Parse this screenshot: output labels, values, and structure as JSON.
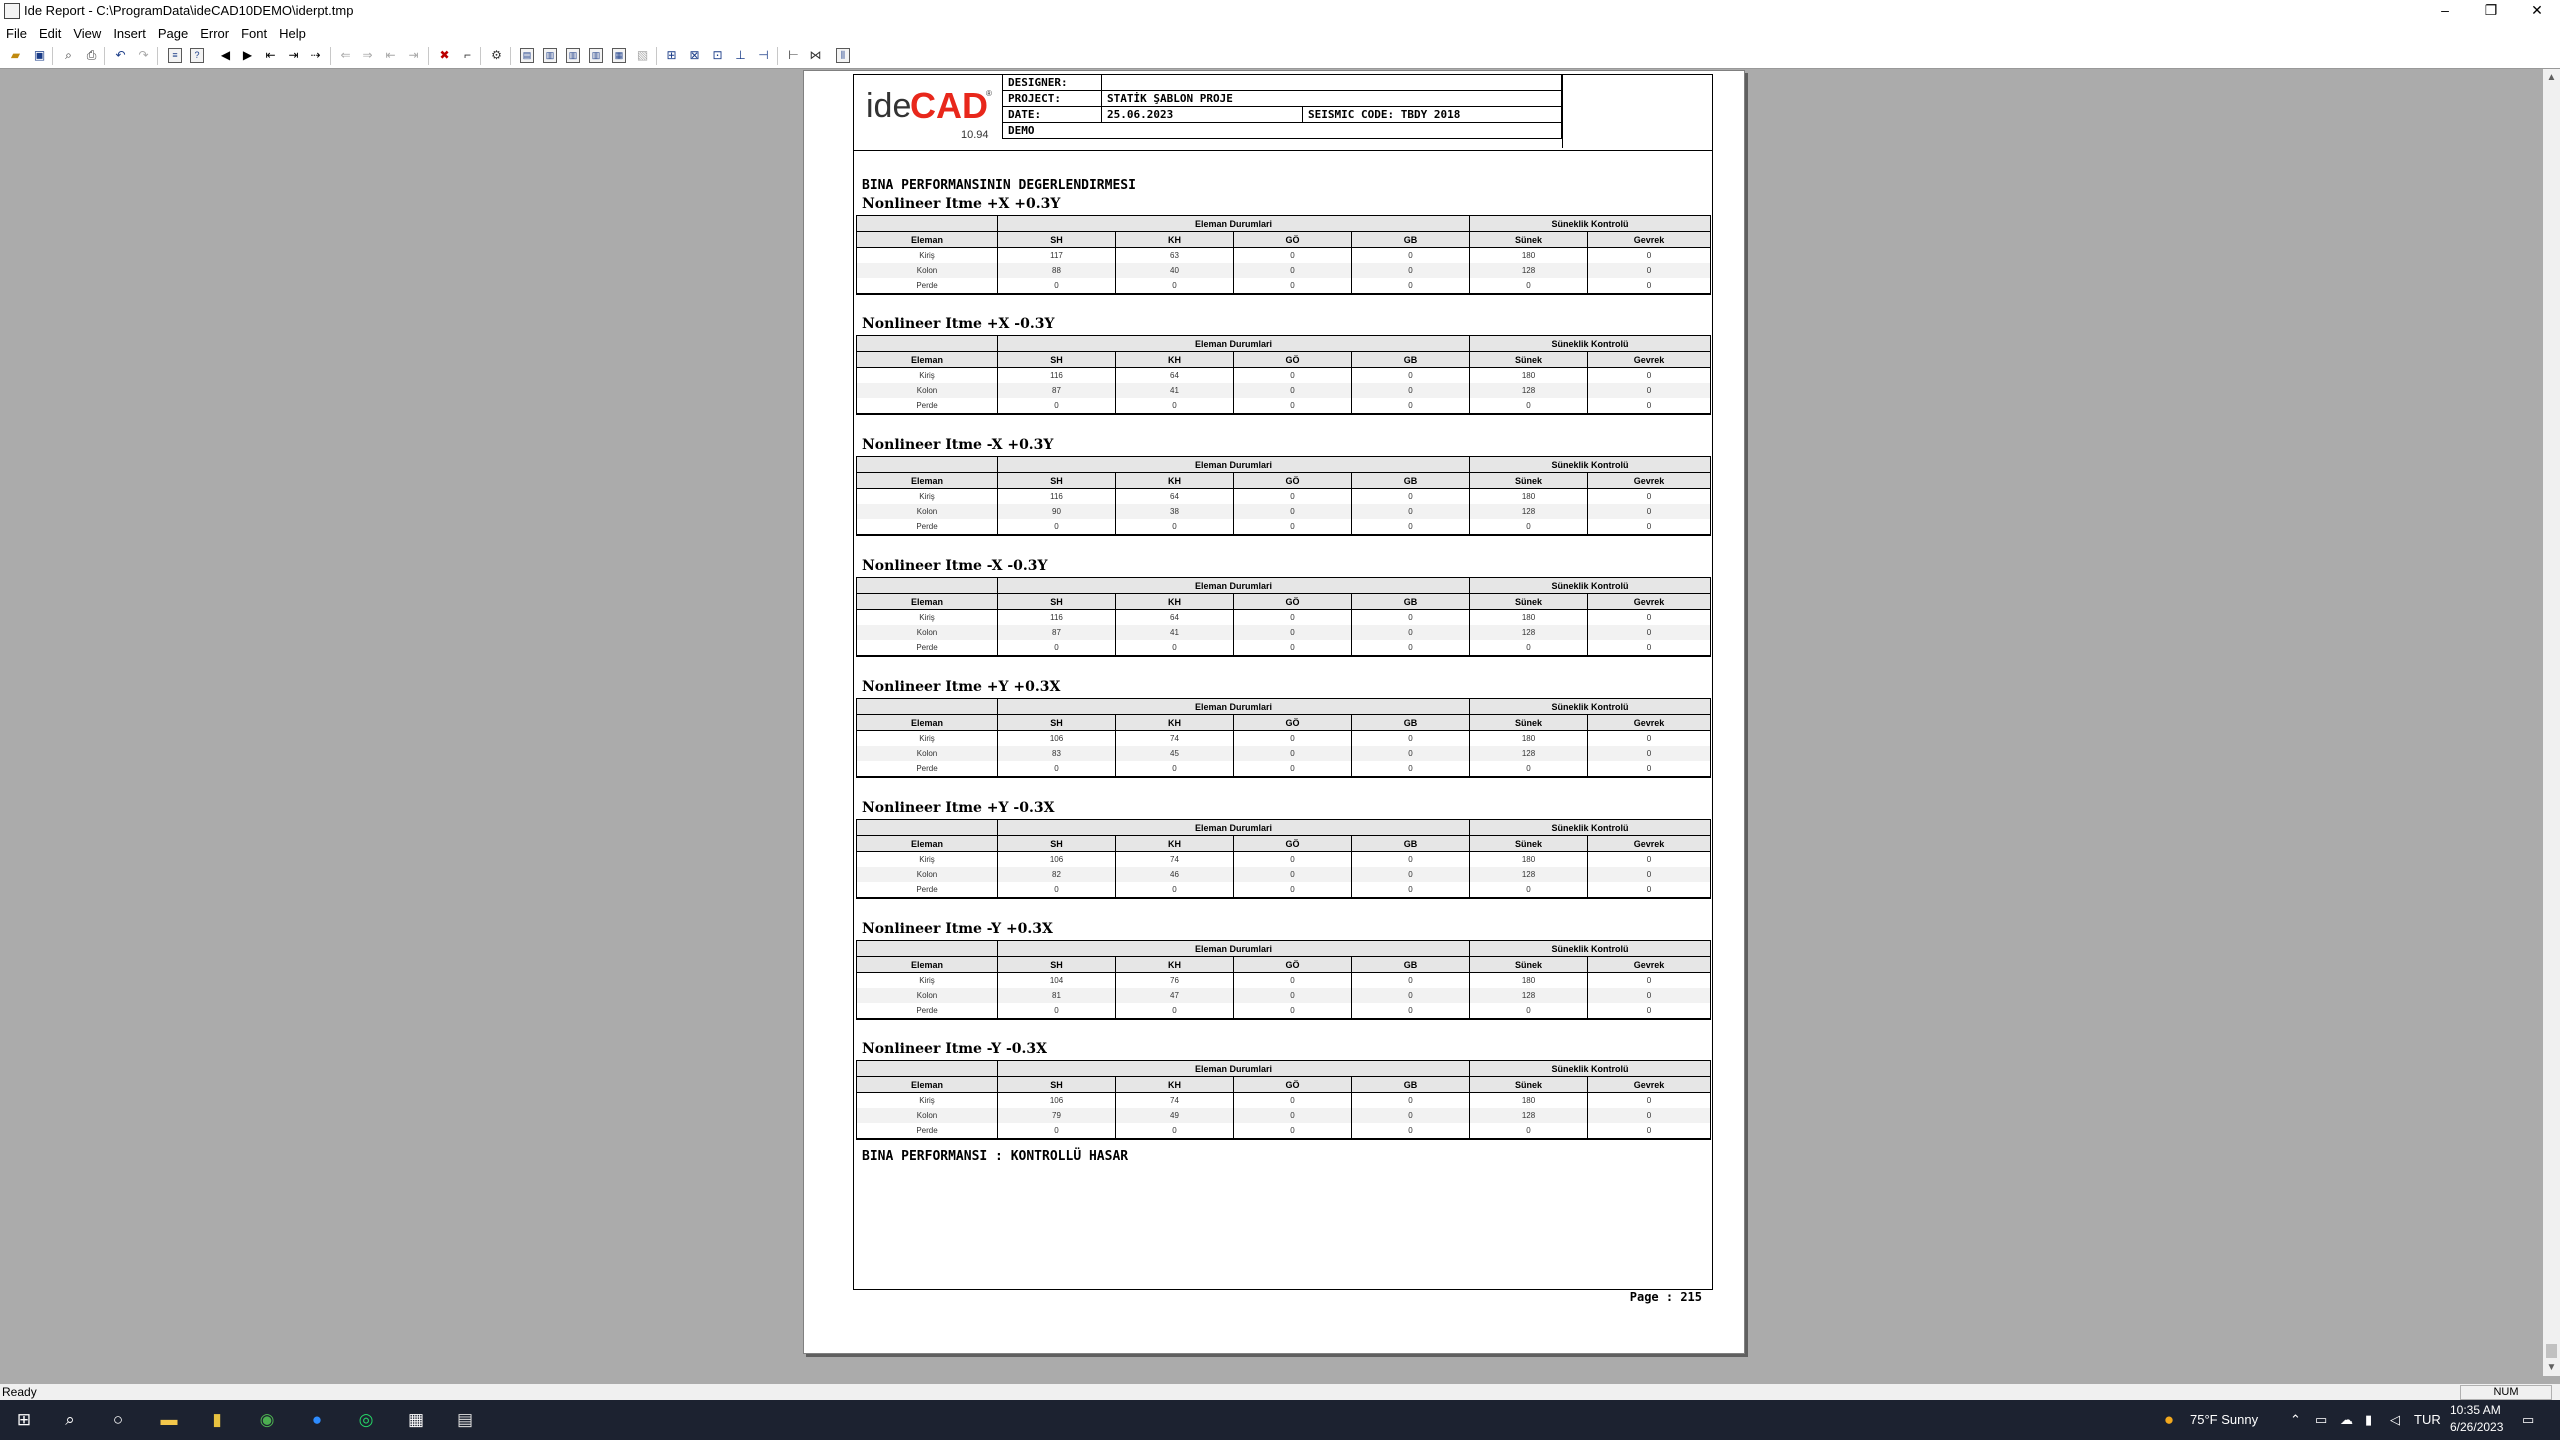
{
  "window": {
    "title": "Ide Report - C:\\ProgramData\\ideCAD10DEMO\\iderpt.tmp",
    "minimize": "–",
    "restore": "❐",
    "close": "✕"
  },
  "menu": [
    "File",
    "Edit",
    "View",
    "Insert",
    "Page",
    "Error",
    "Font",
    "Help"
  ],
  "statusbar": {
    "ready": "Ready",
    "num": "NUM"
  },
  "taskbar": {
    "weather": "75°F  Sunny",
    "lang": "TUR",
    "time": "10:35 AM",
    "date": "6/26/2023"
  },
  "report": {
    "logo": {
      "ide": "ide",
      "cad": "CAD",
      "reg": "®",
      "version": "10.94"
    },
    "header": {
      "designer_label": "DESIGNER:",
      "project_label": "PROJECT:",
      "project_value": "STATİK ŞABLON PROJE",
      "date_label": "DATE:",
      "date_value": "25.06.2023",
      "seismic": "SEISMIC CODE: TBDY 2018",
      "demo": "DEMO"
    },
    "section_title": "BINA PERFORMANSININ DEGERLENDIRMESI",
    "group_headers": {
      "left": "Eleman Durumlari",
      "right": "Süneklik Kontrolü"
    },
    "columns": [
      "Eleman",
      "SH",
      "KH",
      "GÖ",
      "GB",
      "Sünek",
      "Gevrek"
    ],
    "blocks": [
      {
        "title": "Nonlineer Itme +X +0.3Y",
        "rows": [
          [
            "Kiriş",
            "117",
            "63",
            "0",
            "0",
            "180",
            "0"
          ],
          [
            "Kolon",
            "88",
            "40",
            "0",
            "0",
            "128",
            "0"
          ],
          [
            "Perde",
            "0",
            "0",
            "0",
            "0",
            "0",
            "0"
          ]
        ]
      },
      {
        "title": "Nonlineer Itme +X -0.3Y",
        "rows": [
          [
            "Kiriş",
            "116",
            "64",
            "0",
            "0",
            "180",
            "0"
          ],
          [
            "Kolon",
            "87",
            "41",
            "0",
            "0",
            "128",
            "0"
          ],
          [
            "Perde",
            "0",
            "0",
            "0",
            "0",
            "0",
            "0"
          ]
        ]
      },
      {
        "title": "Nonlineer Itme -X +0.3Y",
        "rows": [
          [
            "Kiriş",
            "116",
            "64",
            "0",
            "0",
            "180",
            "0"
          ],
          [
            "Kolon",
            "90",
            "38",
            "0",
            "0",
            "128",
            "0"
          ],
          [
            "Perde",
            "0",
            "0",
            "0",
            "0",
            "0",
            "0"
          ]
        ]
      },
      {
        "title": "Nonlineer Itme -X -0.3Y",
        "rows": [
          [
            "Kiriş",
            "116",
            "64",
            "0",
            "0",
            "180",
            "0"
          ],
          [
            "Kolon",
            "87",
            "41",
            "0",
            "0",
            "128",
            "0"
          ],
          [
            "Perde",
            "0",
            "0",
            "0",
            "0",
            "0",
            "0"
          ]
        ]
      },
      {
        "title": "Nonlineer Itme +Y +0.3X",
        "rows": [
          [
            "Kiriş",
            "106",
            "74",
            "0",
            "0",
            "180",
            "0"
          ],
          [
            "Kolon",
            "83",
            "45",
            "0",
            "0",
            "128",
            "0"
          ],
          [
            "Perde",
            "0",
            "0",
            "0",
            "0",
            "0",
            "0"
          ]
        ]
      },
      {
        "title": "Nonlineer Itme +Y -0.3X",
        "rows": [
          [
            "Kiriş",
            "106",
            "74",
            "0",
            "0",
            "180",
            "0"
          ],
          [
            "Kolon",
            "82",
            "46",
            "0",
            "0",
            "128",
            "0"
          ],
          [
            "Perde",
            "0",
            "0",
            "0",
            "0",
            "0",
            "0"
          ]
        ]
      },
      {
        "title": "Nonlineer Itme -Y +0.3X",
        "rows": [
          [
            "Kiriş",
            "104",
            "76",
            "0",
            "0",
            "180",
            "0"
          ],
          [
            "Kolon",
            "81",
            "47",
            "0",
            "0",
            "128",
            "0"
          ],
          [
            "Perde",
            "0",
            "0",
            "0",
            "0",
            "0",
            "0"
          ]
        ]
      },
      {
        "title": "Nonlineer Itme -Y -0.3X",
        "rows": [
          [
            "Kiriş",
            "106",
            "74",
            "0",
            "0",
            "180",
            "0"
          ],
          [
            "Kolon",
            "79",
            "49",
            "0",
            "0",
            "128",
            "0"
          ],
          [
            "Perde",
            "0",
            "0",
            "0",
            "0",
            "0",
            "0"
          ]
        ]
      }
    ],
    "conclusion": "BINA PERFORMANSI : KONTROLLÜ HASAR",
    "page": "Page : 215"
  }
}
